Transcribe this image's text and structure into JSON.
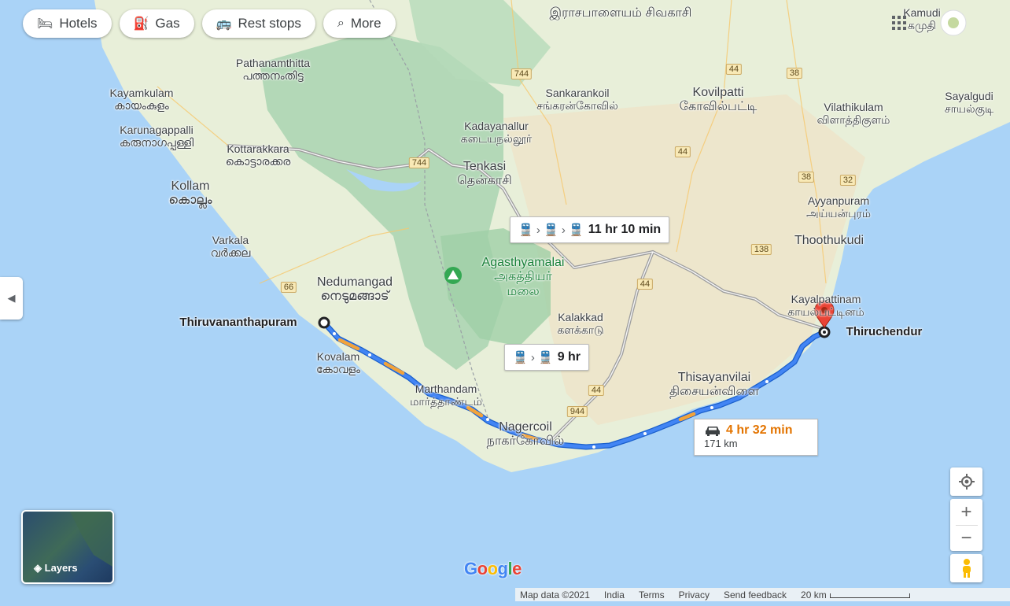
{
  "chips": [
    {
      "label": "Hotels",
      "icon": "bed-icon"
    },
    {
      "label": "Gas",
      "icon": "gas-pump-icon"
    },
    {
      "label": "Rest stops",
      "icon": "rest-stop-icon"
    },
    {
      "label": "More",
      "icon": "search-icon"
    }
  ],
  "places": {
    "pathanamthitta": {
      "en": "Pathanamthitta",
      "ta": "പത്തനംതിട്ട"
    },
    "kayamkulam": {
      "en": "Kayamkulam",
      "ta": "കായംകുളം"
    },
    "karunagappalli": {
      "en": "Karunagappalli",
      "ta": "കരുനാഗപ്പള്ളി"
    },
    "kottarakkara": {
      "en": "Kottarakkara",
      "ta": "കൊട്ടാരക്കര"
    },
    "kollam": {
      "en": "Kollam",
      "ta": "കൊല്ലം"
    },
    "varkala": {
      "en": "Varkala",
      "ta": "വർക്കല"
    },
    "nedumangad": {
      "en": "Nedumangad",
      "ta": "നെടുമങ്ങാട്"
    },
    "kovalam": {
      "en": "Kovalam",
      "ta": "കോവളം"
    },
    "marthandam": {
      "en": "Marthandam",
      "ta": "மார்த்தாண்டம்"
    },
    "nagercoil": {
      "en": "Nagercoil",
      "ta": "நாகர்கோவில்"
    },
    "tenkasi": {
      "en": "Tenkasi",
      "ta": "தென்காசி"
    },
    "kadayanallur": {
      "en": "Kadayanallur",
      "ta": "கடையநல்லூர்"
    },
    "sankarankoil": {
      "en": "Sankarankoil",
      "ta": "சங்கரன்கோவில்"
    },
    "rajapalayam": {
      "ta": "இராசபாளையம் சிவகாசி"
    },
    "kovilpatti": {
      "en": "Kovilpatti",
      "ta": "கோவில்பட்டி"
    },
    "vilathikulam": {
      "en": "Vilathikulam",
      "ta": "விளாத்திகுளம்"
    },
    "sayalgudi": {
      "en": "Sayalgudi",
      "ta": "சாயல்குடி"
    },
    "kamudi": {
      "en": "Kamudi",
      "ta": "கமுதி"
    },
    "ayyanpuram": {
      "en": "Ayyanpuram",
      "ta": "அய்யன்புரம்"
    },
    "thoothukudi": {
      "en": "Thoothukudi"
    },
    "kayalpattinam": {
      "en": "Kayalpattinam",
      "ta": "காயல்பட்டினம்"
    },
    "kalakkad": {
      "en": "Kalakkad",
      "ta": "களக்காடு"
    },
    "thisayanvilai": {
      "en": "Thisayanvilai",
      "ta": "திசையன்விளை"
    },
    "agasthyamalai": {
      "en": "Agasthyamalai",
      "ta": "அகத்தியர்",
      "ta2": "மலை"
    }
  },
  "route": {
    "origin": "Thiruvananthapuram",
    "destination": "Thiruchendur",
    "car_time": "4 hr 32 min",
    "car_distance": "171 km",
    "transit1": "11 hr 10 min",
    "transit2": "9 hr",
    "route_color": "#4285f4",
    "traffic_color": "#f2a33a"
  },
  "highways": [
    "744",
    "44",
    "38",
    "44",
    "744",
    "38",
    "32",
    "138",
    "66",
    "44",
    "44",
    "944"
  ],
  "footer": {
    "map_data": "Map data ©2021",
    "country": "India",
    "terms": "Terms",
    "privacy": "Privacy",
    "feedback": "Send feedback",
    "scale": "20 km"
  },
  "layers_label": "Layers",
  "google_logo": "Google",
  "controls": {
    "zoom_in": "+",
    "zoom_out": "−"
  },
  "colors": {
    "water": "#aad3f7",
    "land": "#e8efd9",
    "forest": "#a9d4b0",
    "dry": "#ede3c8"
  }
}
